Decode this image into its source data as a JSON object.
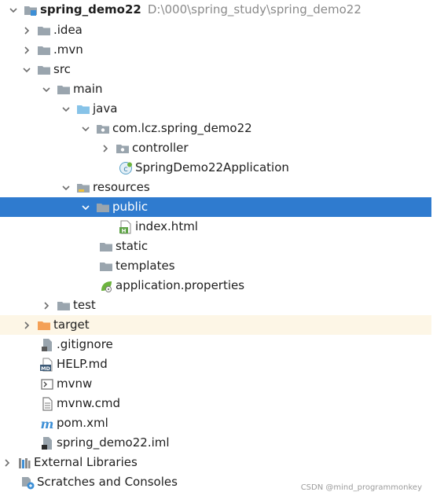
{
  "project": {
    "name": "spring_demo22",
    "path": "D:\\000\\spring_study\\spring_demo22"
  },
  "tree": {
    "idea": ".idea",
    "mvn": ".mvn",
    "src": "src",
    "main": "main",
    "java": "java",
    "package": "com.lcz.spring_demo22",
    "controller": "controller",
    "app_class": "SpringDemo22Application",
    "resources": "resources",
    "public": "public",
    "index_html": "index.html",
    "static": "static",
    "templates": "templates",
    "app_props": "application.properties",
    "test": "test",
    "target": "target",
    "gitignore": ".gitignore",
    "help_md": "HELP.md",
    "mvnw": "mvnw",
    "mvnw_cmd": "mvnw.cmd",
    "pom_xml": "pom.xml",
    "iml": "spring_demo22.iml",
    "external_libraries": "External Libraries",
    "scratches": "Scratches and Consoles"
  },
  "watermark": "CSDN @mind_programmonkey",
  "colors": {
    "selection": "#2f7bcf",
    "folder_gray": "#9aa5ae",
    "folder_blue": "#87c3e8",
    "folder_orange": "#f4a056",
    "excluded_bg": "#fdf6e6",
    "path_gray": "#8a8a8a"
  }
}
